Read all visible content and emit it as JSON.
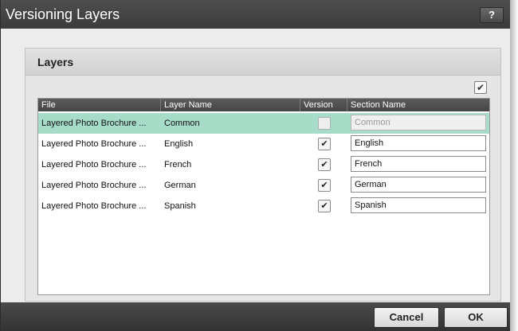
{
  "dialog": {
    "title": "Versioning Layers",
    "help_label": "?"
  },
  "panel": {
    "title": "Layers",
    "select_all_checked": true
  },
  "table": {
    "columns": [
      "File",
      "Layer Name",
      "Version",
      "Section Name"
    ],
    "rows": [
      {
        "file": "Layered Photo Brochure ...",
        "layer": "Common",
        "version": false,
        "section": "Common",
        "selected": true,
        "section_disabled": true
      },
      {
        "file": "Layered Photo Brochure ...",
        "layer": "English",
        "version": true,
        "section": "English",
        "selected": false,
        "section_disabled": false
      },
      {
        "file": "Layered Photo Brochure ...",
        "layer": "French",
        "version": true,
        "section": "French",
        "selected": false,
        "section_disabled": false
      },
      {
        "file": "Layered Photo Brochure ...",
        "layer": "German",
        "version": true,
        "section": "German",
        "selected": false,
        "section_disabled": false
      },
      {
        "file": "Layered Photo Brochure ...",
        "layer": "Spanish",
        "version": true,
        "section": "Spanish",
        "selected": false,
        "section_disabled": false
      }
    ]
  },
  "footer": {
    "cancel_label": "Cancel",
    "ok_label": "OK"
  },
  "colors": {
    "selected_row": "#a6dcc8",
    "title_bar": "#444444"
  }
}
